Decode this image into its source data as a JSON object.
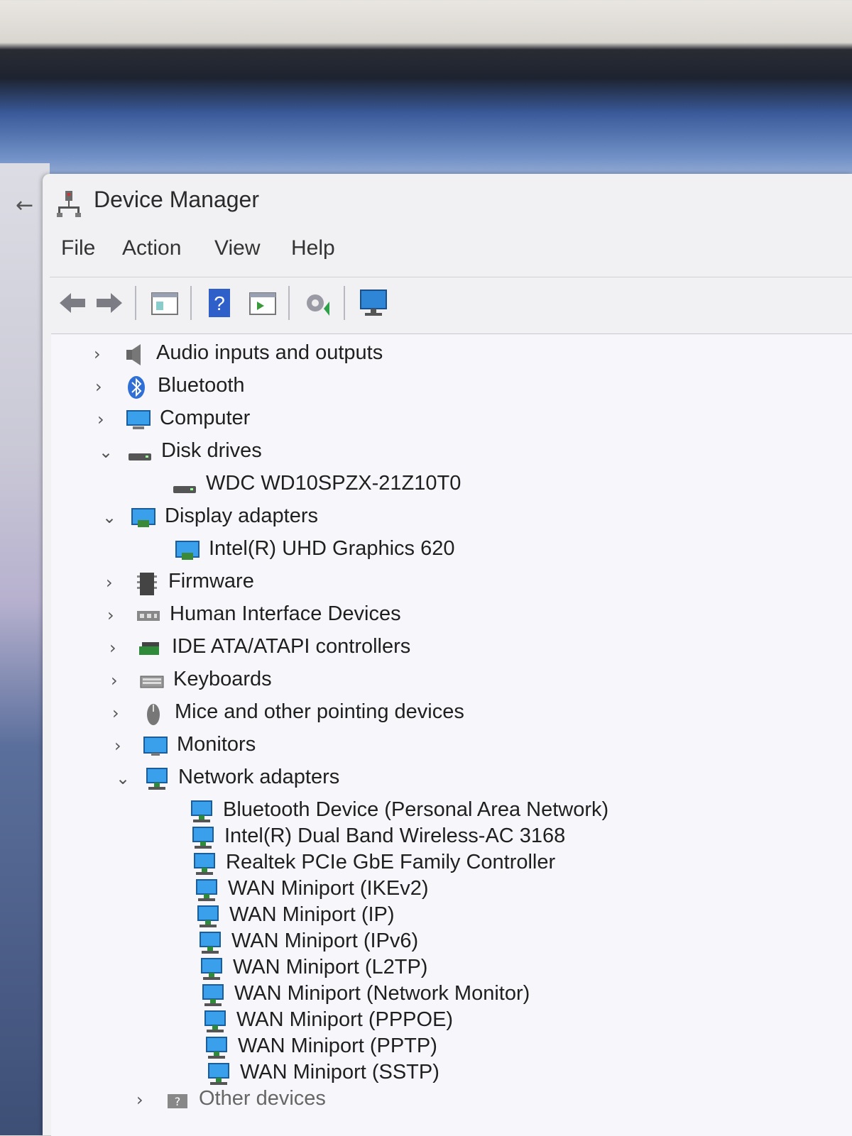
{
  "window": {
    "title": "Device Manager"
  },
  "menu": [
    "File",
    "Action",
    "View",
    "Help"
  ],
  "toolbar": {
    "icons": [
      "back-arrow-icon",
      "forward-arrow-icon",
      "properties-icon",
      "help-icon",
      "driver-details-icon",
      "update-driver-icon",
      "monitor-scan-icon"
    ]
  },
  "tree": {
    "categories": [
      {
        "label": "Audio inputs and outputs",
        "expanded": false,
        "icon": "speaker-icon"
      },
      {
        "label": "Bluetooth",
        "expanded": false,
        "icon": "bluetooth-icon"
      },
      {
        "label": "Computer",
        "expanded": false,
        "icon": "computer-icon"
      },
      {
        "label": "Disk drives",
        "expanded": true,
        "icon": "disk-drive-icon",
        "children": [
          "WDC WD10SPZX-21Z10T0"
        ]
      },
      {
        "label": "Display adapters",
        "expanded": true,
        "icon": "display-adapter-icon",
        "children": [
          "Intel(R) UHD Graphics 620"
        ]
      },
      {
        "label": "Firmware",
        "expanded": false,
        "icon": "firmware-icon"
      },
      {
        "label": "Human Interface Devices",
        "expanded": false,
        "icon": "hid-icon"
      },
      {
        "label": "IDE ATA/ATAPI controllers",
        "expanded": false,
        "icon": "ide-controller-icon"
      },
      {
        "label": "Keyboards",
        "expanded": false,
        "icon": "keyboard-icon"
      },
      {
        "label": "Mice and other pointing devices",
        "expanded": false,
        "icon": "mouse-icon"
      },
      {
        "label": "Monitors",
        "expanded": false,
        "icon": "monitor-icon"
      },
      {
        "label": "Network adapters",
        "expanded": true,
        "icon": "network-adapter-icon",
        "children": [
          "Bluetooth Device (Personal Area Network)",
          "Intel(R) Dual Band Wireless-AC 3168",
          "Realtek PCIe GbE Family Controller",
          "WAN Miniport (IKEv2)",
          "WAN Miniport (IP)",
          "WAN Miniport (IPv6)",
          "WAN Miniport (L2TP)",
          "WAN Miniport (Network Monitor)",
          "WAN Miniport (PPPOE)",
          "WAN Miniport (PPTP)",
          "WAN Miniport (SSTP)"
        ]
      },
      {
        "label": "Other devices",
        "expanded": false,
        "icon": "other-devices-icon"
      }
    ]
  },
  "colors": {
    "accent": "#2f86d6",
    "text": "#1f1f1f"
  }
}
